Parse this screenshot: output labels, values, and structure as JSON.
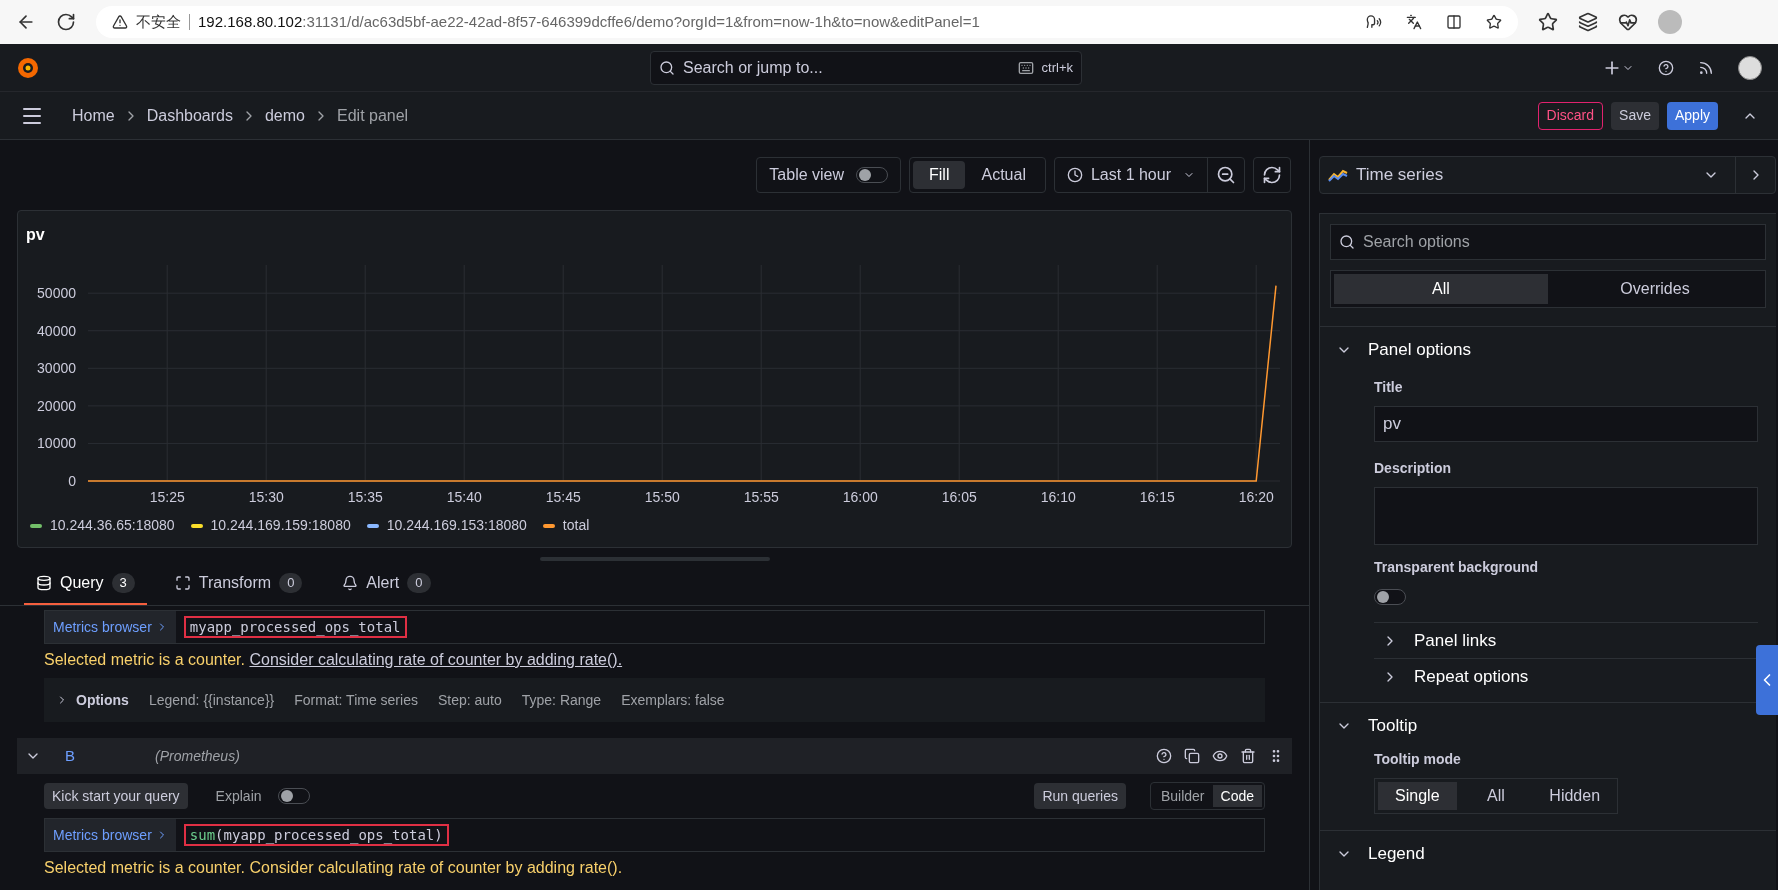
{
  "browser": {
    "security": "不安全",
    "url_host": "192.168.80.102",
    "url_rest": ":31131/d/ac63d5bf-ae22-42ad-8f57-646399dcffe6/demo?orgId=1&from=now-1h&to=now&editPanel=1"
  },
  "topbar": {
    "search_placeholder": "Search or jump to...",
    "shortcut": "ctrl+k"
  },
  "breadcrumbs": [
    "Home",
    "Dashboards",
    "demo",
    "Edit panel"
  ],
  "actions": [
    {
      "label": "Discard",
      "kind": "danger"
    },
    {
      "label": "Save",
      "kind": "secondary"
    },
    {
      "label": "Apply",
      "kind": "primary"
    }
  ],
  "toolbar": {
    "table_view": {
      "label": "Table view",
      "on": false
    },
    "fill_modes": [
      {
        "label": "Fill",
        "selected": true
      },
      {
        "label": "Actual",
        "selected": false
      }
    ],
    "time_range": "Last 1 hour"
  },
  "panel": {
    "title": "pv",
    "chart_data": {
      "type": "line",
      "grid": true,
      "categories": [
        null,
        null,
        null,
        null,
        "15:25",
        null,
        null,
        null,
        null,
        "15:30",
        null,
        null,
        null,
        null,
        "15:35",
        null,
        null,
        null,
        null,
        "15:40",
        null,
        null,
        null,
        null,
        "15:45",
        null,
        null,
        null,
        null,
        "15:50",
        null,
        null,
        null,
        null,
        "15:55",
        null,
        null,
        null,
        null,
        "16:00",
        null,
        null,
        null,
        null,
        "16:05",
        null,
        null,
        null,
        null,
        "16:10",
        null,
        null,
        null,
        null,
        "16:15",
        null,
        null,
        null,
        null,
        "16:20",
        null
      ],
      "ylim": [
        0,
        57500
      ],
      "yticks": [
        0,
        10000,
        20000,
        30000,
        40000,
        50000
      ],
      "series": [
        {
          "name": "10.244.36.65:18080",
          "color": "#73bf69",
          "values": [
            null,
            null,
            null,
            null,
            null,
            null,
            null,
            null,
            null,
            null,
            null,
            null,
            null,
            null,
            null,
            null,
            null,
            null,
            null,
            null,
            null,
            null,
            null,
            null,
            null,
            null,
            null,
            null,
            null,
            null,
            null,
            null,
            null,
            null,
            null,
            null,
            null,
            null,
            null,
            null,
            null,
            null,
            null,
            null,
            null,
            null,
            null,
            null,
            null,
            null,
            null,
            null,
            null,
            null,
            null,
            null,
            null,
            null,
            null,
            null,
            null
          ]
        },
        {
          "name": "10.244.169.159:18080",
          "color": "#fade2a",
          "values": [
            null,
            null,
            null,
            null,
            null,
            null,
            null,
            null,
            null,
            null,
            null,
            null,
            null,
            null,
            null,
            null,
            null,
            null,
            null,
            null,
            null,
            null,
            null,
            null,
            null,
            null,
            null,
            null,
            null,
            null,
            null,
            null,
            null,
            null,
            null,
            null,
            null,
            null,
            null,
            null,
            null,
            null,
            null,
            null,
            null,
            null,
            null,
            null,
            null,
            null,
            null,
            null,
            null,
            null,
            null,
            null,
            null,
            null,
            null,
            null,
            null
          ]
        },
        {
          "name": "10.244.169.153:18080",
          "color": "#8ab8ff",
          "values": [
            null,
            null,
            null,
            null,
            null,
            null,
            null,
            null,
            null,
            null,
            null,
            null,
            null,
            null,
            null,
            null,
            null,
            null,
            null,
            null,
            null,
            null,
            null,
            null,
            null,
            null,
            null,
            null,
            null,
            null,
            null,
            null,
            null,
            null,
            null,
            null,
            null,
            null,
            null,
            null,
            null,
            null,
            null,
            null,
            null,
            null,
            null,
            null,
            null,
            null,
            null,
            null,
            null,
            null,
            null,
            null,
            null,
            null,
            null,
            null,
            null
          ]
        },
        {
          "name": "total",
          "color": "#ff9830",
          "values": [
            0,
            0,
            0,
            0,
            0,
            0,
            0,
            0,
            0,
            0,
            0,
            0,
            0,
            0,
            0,
            0,
            0,
            0,
            0,
            0,
            0,
            0,
            0,
            0,
            0,
            0,
            0,
            0,
            0,
            0,
            0,
            0,
            0,
            0,
            0,
            0,
            0,
            0,
            0,
            0,
            0,
            0,
            0,
            0,
            0,
            0,
            0,
            0,
            0,
            0,
            0,
            0,
            0,
            0,
            0,
            0,
            0,
            0,
            0,
            0,
            52000
          ]
        }
      ]
    }
  },
  "query_tabs": [
    {
      "label": "Query",
      "count": "3",
      "selected": true
    },
    {
      "label": "Transform",
      "count": "0",
      "selected": false
    },
    {
      "label": "Alert",
      "count": "0",
      "selected": false
    }
  ],
  "query_a": {
    "metrics_browser": "Metrics browser",
    "query": [
      {
        "text": "myapp_processed_ops_total",
        "kind": "plain"
      }
    ],
    "warning": "Selected metric is a counter.",
    "warning_link": "Consider calculating rate of counter by adding rate().",
    "options_label": "Options",
    "options": [
      "Legend: {{instance}}",
      "Format: Time series",
      "Step: auto",
      "Type: Range",
      "Exemplars: false"
    ]
  },
  "query_b": {
    "letter": "B",
    "datasource": "(Prometheus)",
    "expanded": true,
    "kick_start": "Kick start your query",
    "explain": {
      "label": "Explain",
      "on": false
    },
    "run": "Run queries",
    "modes": [
      {
        "label": "Builder",
        "selected": false
      },
      {
        "label": "Code",
        "selected": true
      }
    ],
    "metrics_browser": "Metrics browser",
    "query": [
      {
        "text": "sum",
        "kind": "function"
      },
      {
        "text": "(myapp_processed_ops_total)",
        "kind": "plain"
      }
    ],
    "warning": "Selected metric is a counter. Consider calculating rate of counter by adding rate()."
  },
  "options_pane": {
    "visualization": "Time series",
    "search_placeholder": "Search options",
    "tabs": [
      {
        "label": "All",
        "selected": true
      },
      {
        "label": "Overrides",
        "selected": false
      }
    ],
    "panel_options": {
      "title": "Panel options",
      "expanded": true,
      "title_label": "Title",
      "title_value": "pv",
      "description_label": "Description",
      "transparent_label": "Transparent background",
      "transparent_on": false,
      "subsections": [
        {
          "label": "Panel links",
          "expanded": false
        },
        {
          "label": "Repeat options",
          "expanded": false
        }
      ]
    },
    "tooltip": {
      "title": "Tooltip",
      "expanded": true,
      "mode_label": "Tooltip mode",
      "modes": [
        {
          "label": "Single",
          "selected": true
        },
        {
          "label": "All",
          "selected": false
        },
        {
          "label": "Hidden",
          "selected": false
        }
      ]
    },
    "legend": {
      "title": "Legend",
      "expanded": true
    }
  }
}
